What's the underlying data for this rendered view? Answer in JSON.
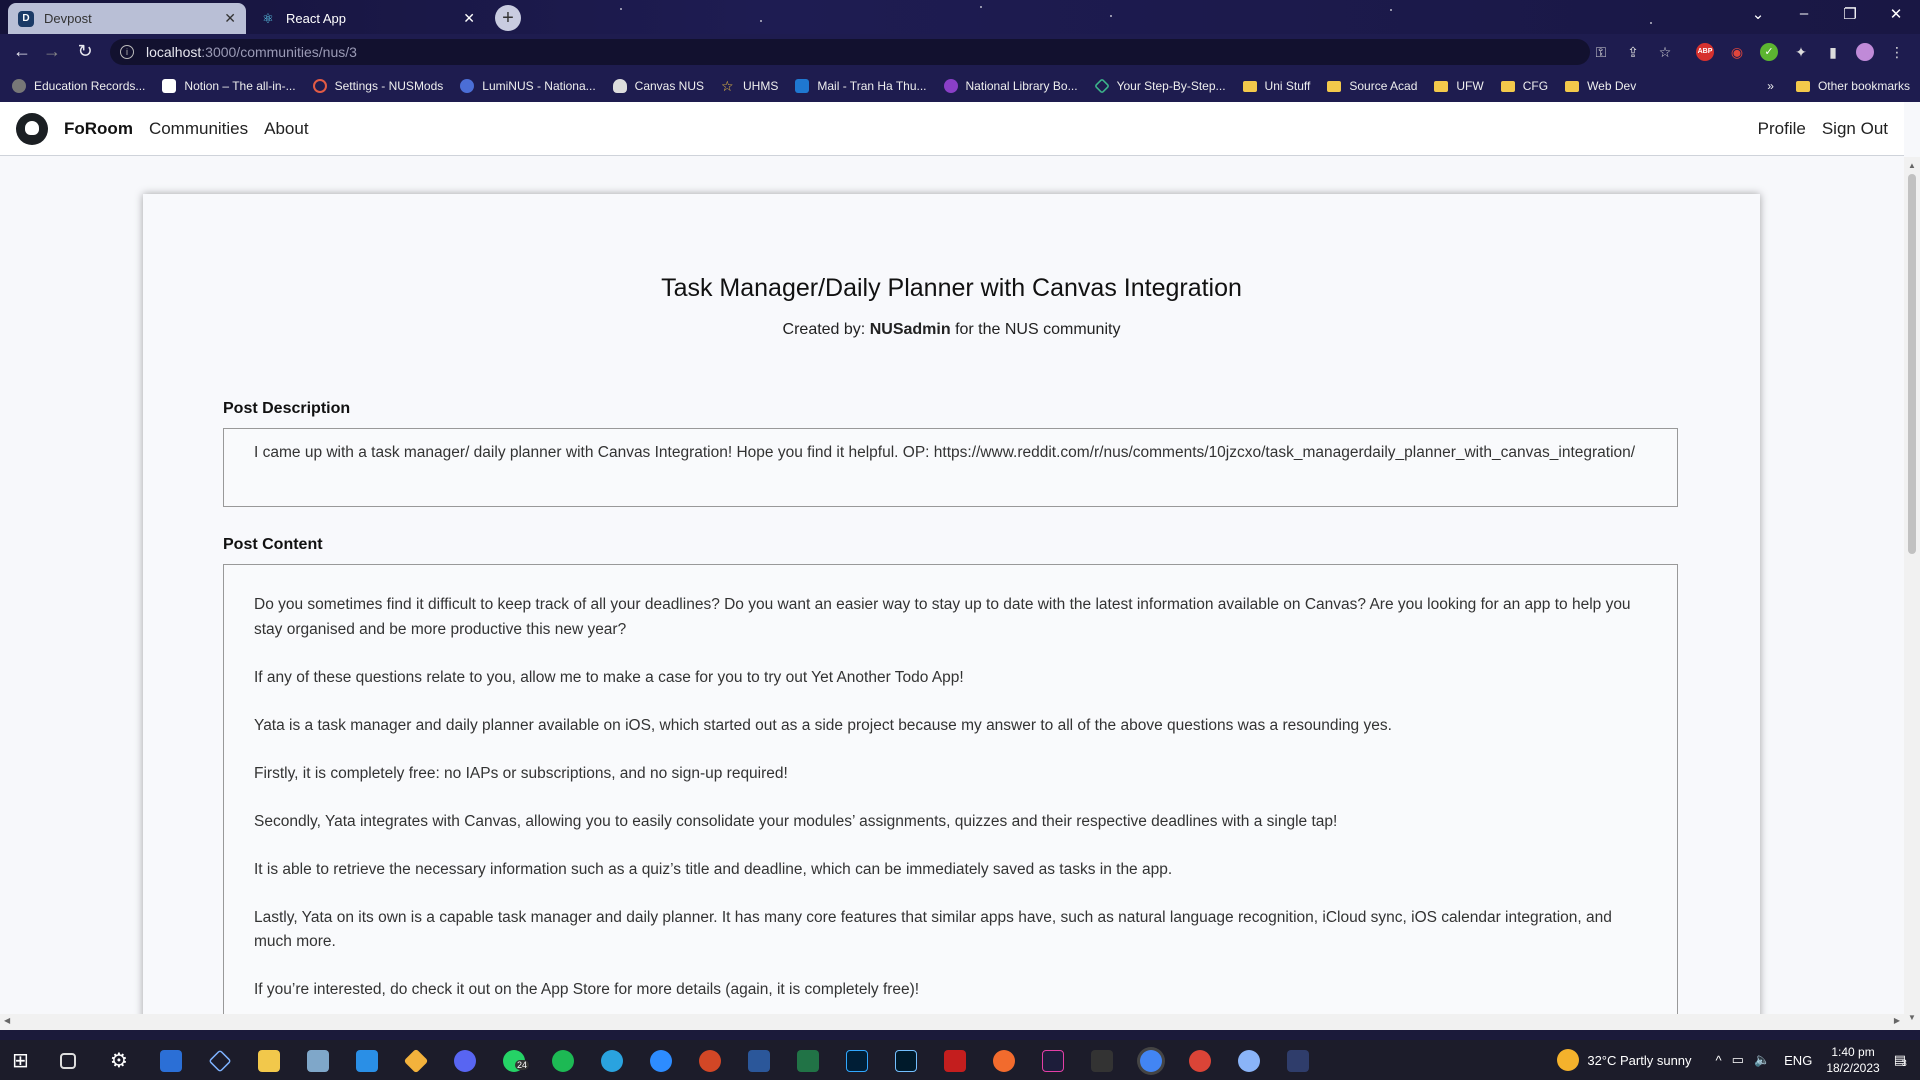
{
  "browser": {
    "tabs": [
      {
        "title": "Devpost",
        "favicon": "D",
        "active": false
      },
      {
        "title": "React App",
        "active": true
      }
    ],
    "address": {
      "host": "localhost",
      "path": ":3000/communities/nus/3"
    },
    "bookmarks": [
      "Education Records...",
      "Notion – The all-in-...",
      "Settings - NUSMods",
      "LumiNUS - Nationa...",
      "Canvas NUS",
      "UHMS",
      "Mail - Tran Ha Thu...",
      "National Library Bo...",
      "Your Step-By-Step...",
      "Uni Stuff",
      "Source Acad",
      "UFW",
      "CFG",
      "Web Dev"
    ],
    "other_bookmarks": "Other bookmarks",
    "overflow": "»"
  },
  "app": {
    "brand": "FoRoom",
    "nav": [
      "Communities",
      "About"
    ],
    "nav_right": [
      "Profile",
      "Sign Out"
    ]
  },
  "post": {
    "title": "Task Manager/Daily Planner with Canvas Integration",
    "created_prefix": "Created by:",
    "author": "NUSadmin",
    "created_suffix": "for the NUS community",
    "description_label": "Post Description",
    "description": "I came up with a task manager/ daily planner with Canvas Integration! Hope you find it helpful. OP: https://www.reddit.com/r/nus/comments/10jzcxo/task_managerdaily_planner_with_canvas_integration/",
    "content_label": "Post Content",
    "paragraphs": [
      "Do you sometimes find it difficult to keep track of all your deadlines? Do you want an easier way to stay up to date with the latest information available on Canvas? Are you looking for an app to help you stay organised and be more productive this new year?",
      "If any of these questions relate to you, allow me to make a case for you to try out Yet Another Todo App!",
      "Yata is a task manager and daily planner available on iOS, which started out as a side project because my answer to all of the above questions was a resounding yes.",
      "Firstly, it is completely free: no IAPs or subscriptions, and no sign-up required!",
      "Secondly, Yata integrates with Canvas, allowing you to easily consolidate your modules’ assignments, quizzes and their respective deadlines with a single tap!",
      "It is able to retrieve the necessary information such as a quiz’s title and deadline, which can be immediately saved as tasks in the app.",
      "Lastly, Yata on its own is a capable task manager and daily planner. It has many core features that similar apps have, such as natural language recognition, iCloud sync, iOS calendar integration, and much more.",
      "If you’re interested, do check it out on the App Store for more details (again, it is completely free)!"
    ]
  },
  "taskbar": {
    "weather": "32°C  Partly sunny",
    "lang": "ENG",
    "time": "1:40 pm",
    "date": "18/2/2023",
    "whatsapp_badge": "24",
    "notif_count": "3"
  }
}
